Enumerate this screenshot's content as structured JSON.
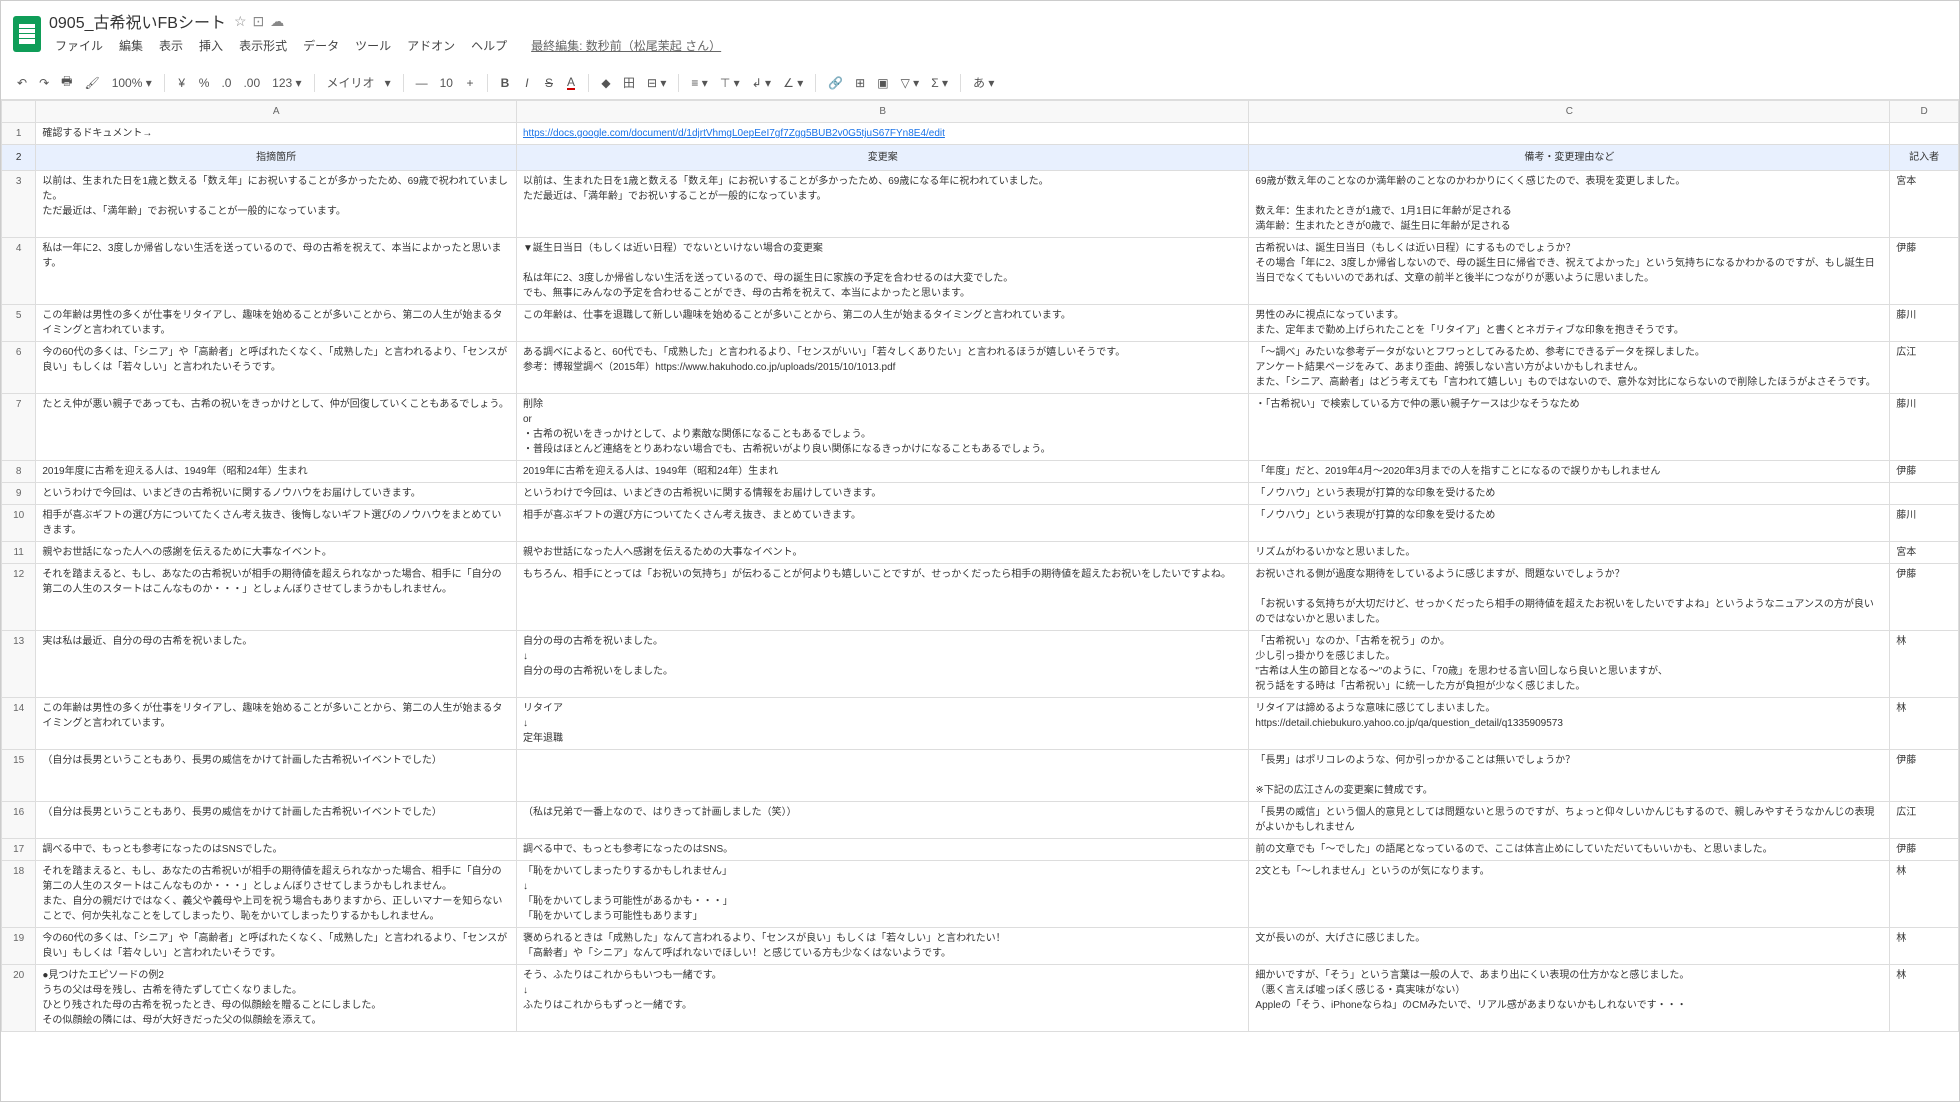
{
  "doc": {
    "title": "0905_古希祝いFBシート",
    "star": "☆",
    "folder": "⊡",
    "cloud": "☁"
  },
  "menu": {
    "file": "ファイル",
    "edit": "編集",
    "view": "表示",
    "insert": "挿入",
    "format": "表示形式",
    "data": "データ",
    "tools": "ツール",
    "addons": "アドオン",
    "help": "ヘルプ",
    "last_edit": "最終編集: 数秒前（松尾茉起 さん）"
  },
  "toolbar": {
    "undo": "↶",
    "redo": "↷",
    "print": "🖶",
    "paint": "🖌",
    "zoom": "100%",
    "dropdown": "▾",
    "currency": "¥",
    "percent": "%",
    "dec_dec": ".0",
    "dec_inc": ".00",
    "more_fmt": "123",
    "font": "メイリオ",
    "font_size": "10",
    "minus": "—",
    "bold": "B",
    "italic": "I",
    "strike": "S",
    "text_color": "A",
    "fill": "◆",
    "borders": "田",
    "merge": "⊟",
    "halign": "≡",
    "valign": "⊤",
    "wrap": "↲",
    "rotate": "∠",
    "link": "🔗",
    "comment": "⊞",
    "image": "▣",
    "filter": "▽",
    "sigma": "Σ",
    "lang": "あ"
  },
  "headers": {
    "A": "A",
    "B": "B",
    "C": "C",
    "D": "D",
    "row1_a": "確認するドキュメント→",
    "row1_b_link": "https://docs.google.com/document/d/1djrtVhmgL0epEeI7gf7Zgg5BUB2v0G5tjuS67FYn8E4/edit",
    "row2_a": "指摘箇所",
    "row2_b": "変更案",
    "row2_c": "備考・変更理由など",
    "row2_d": "記入者"
  },
  "rows": [
    {
      "n": "3",
      "a": "以前は、生まれた日を1歳と数える「数え年」にお祝いすることが多かったため、69歳で祝われていました。\nただ最近は、「満年齢」でお祝いすることが一般的になっています。",
      "b": "以前は、生まれた日を1歳と数える「数え年」にお祝いすることが多かったため、69歳になる年に祝われていました。\nただ最近は、「満年齢」でお祝いすることが一般的になっています。",
      "c": "69歳が数え年のことなのか満年齢のことなのかわかりにくく感じたので、表現を変更しました。\n\n数え年：生まれたときが1歳で、1月1日に年齢が足される\n満年齢：生まれたときが0歳で、誕生日に年齢が足される",
      "d": "宮本"
    },
    {
      "n": "4",
      "a": "私は一年に2、3度しか帰省しない生活を送っているので、母の古希を祝えて、本当によかったと思います。",
      "b": "▼誕生日当日（もしくは近い日程）でないといけない場合の変更案\n\n私は年に2、3度しか帰省しない生活を送っているので、母の誕生日に家族の予定を合わせるのは大変でした。\nでも、無事にみんなの予定を合わせることができ、母の古希を祝えて、本当によかったと思います。",
      "c": "古希祝いは、誕生日当日（もしくは近い日程）にするものでしょうか？\nその場合「年に2、3度しか帰省しないので、母の誕生日に帰省でき、祝えてよかった」という気持ちになるかわかるのですが、もし誕生日当日でなくてもいいのであれば、文章の前半と後半につながりが悪いように思いました。",
      "d": "伊藤"
    },
    {
      "n": "5",
      "a": "この年齢は男性の多くが仕事をリタイアし、趣味を始めることが多いことから、第二の人生が始まるタイミングと言われています。",
      "b": "この年齢は、仕事を退職して新しい趣味を始めることが多いことから、第二の人生が始まるタイミングと言われています。",
      "c": "男性のみに視点になっています。\nまた、定年まで勤め上げられたことを「リタイア」と書くとネガティブな印象を抱きそうです。",
      "d": "藤川"
    },
    {
      "n": "6",
      "a": "今の60代の多くは、「シニア」や「高齢者」と呼ばれたくなく、「成熟した」と言われるより、「センスが良い」もしくは「若々しい」と言われたいそうです。",
      "b": "ある調べによると、60代でも、「成熟した」と言われるより、「センスがいい」「若々しくありたい」と言われるほうが嬉しいそうです。\n参考：博報堂調べ（2015年）https://www.hakuhodo.co.jp/uploads/2015/10/1013.pdf",
      "c": "「～調べ」みたいな参考データがないとフワっとしてみるため、参考にできるデータを探しました。\nアンケート結果ページをみて、あまり歪曲、誇張しない言い方がよいかもしれません。\nまた、「シニア、高齢者」はどう考えても「言われて嬉しい」ものではないので、意外な対比にならないので削除したほうがよさそうです。",
      "d": "広江"
    },
    {
      "n": "7",
      "a": "たとえ仲が悪い親子であっても、古希の祝いをきっかけとして、仲が回復していくこともあるでしょう。",
      "b": "削除\nor\n・古希の祝いをきっかけとして、より素敵な関係になることもあるでしょう。\n・普段はほとんど連絡をとりあわない場合でも、古希祝いがより良い関係になるきっかけになることもあるでしょう。",
      "c": "・「古希祝い」で検索している方で仲の悪い親子ケースは少なそうなため",
      "d": "藤川"
    },
    {
      "n": "8",
      "a": "2019年度に古希を迎える人は、1949年（昭和24年）生まれ",
      "b": "2019年に古希を迎える人は、1949年（昭和24年）生まれ",
      "c": "「年度」だと、2019年4月～2020年3月までの人を指すことになるので誤りかもしれません",
      "d": "伊藤"
    },
    {
      "n": "9",
      "a": "というわけで今回は、いまどきの古希祝いに関するノウハウをお届けしていきます。",
      "b": "というわけで今回は、いまどきの古希祝いに関する情報をお届けしていきます。",
      "c": "「ノウハウ」という表現が打算的な印象を受けるため",
      "d": ""
    },
    {
      "n": "10",
      "a": "相手が喜ぶギフトの選び方についてたくさん考え抜き、後悔しないギフト選びのノウハウをまとめていきます。",
      "b": "相手が喜ぶギフトの選び方についてたくさん考え抜き、まとめていきます。",
      "c": "「ノウハウ」という表現が打算的な印象を受けるため",
      "d": "藤川"
    },
    {
      "n": "11",
      "a": "親やお世話になった人への感謝を伝えるために大事なイベント。",
      "b": "親やお世話になった人へ感謝を伝えるための大事なイベント。",
      "c": "リズムがわるいかなと思いました。",
      "d": "宮本"
    },
    {
      "n": "12",
      "a": "それを踏まえると、もし、あなたの古希祝いが相手の期待値を超えられなかった場合、相手に「自分の第二の人生のスタートはこんなものか・・・」としょんぼりさせてしまうかもしれません。",
      "b": "もちろん、相手にとっては「お祝いの気持ち」が伝わることが何よりも嬉しいことですが、せっかくだったら相手の期待値を超えたお祝いをしたいですよね。",
      "c": "お祝いされる側が過度な期待をしているように感じますが、問題ないでしょうか？\n\n「お祝いする気持ちが大切だけど、せっかくだったら相手の期待値を超えたお祝いをしたいですよね」というようなニュアンスの方が良いのではないかと思いました。",
      "d": "伊藤"
    },
    {
      "n": "13",
      "a": "実は私は最近、自分の母の古希を祝いました。",
      "b": "自分の母の古希を祝いました。\n↓\n自分の母の古希祝いをしました。",
      "c": "「古希祝い」なのか、「古希を祝う」のか。\n少し引っ掛かりを感じました。\n\"古希は人生の節目となる～\"のように、「70歳」を思わせる言い回しなら良いと思いますが、\n祝う話をする時は「古希祝い」に統一した方が負担が少なく感じました。",
      "d": "林"
    },
    {
      "n": "14",
      "a": "この年齢は男性の多くが仕事をリタイアし、趣味を始めることが多いことから、第二の人生が始まるタイミングと言われています。",
      "b": "リタイア\n↓\n定年退職",
      "c": "リタイアは諦めるような意味に感じてしまいました。\nhttps://detail.chiebukuro.yahoo.co.jp/qa/question_detail/q1335909573",
      "d": "林"
    },
    {
      "n": "15",
      "a": "（自分は長男ということもあり、長男の威信をかけて計画した古希祝いイベントでした）",
      "b": "",
      "c": "「長男」はポリコレのような、何か引っかかることは無いでしょうか？\n\n※下記の広江さんの変更案に賛成です。",
      "d": "伊藤"
    },
    {
      "n": "16",
      "a": "（自分は長男ということもあり、長男の威信をかけて計画した古希祝いイベントでした）",
      "b": "（私は兄弟で一番上なので、はりきって計画しました（笑））",
      "c": "「長男の威信」という個人的意見としては問題ないと思うのですが、ちょっと仰々しいかんじもするので、親しみやすそうなかんじの表現がよいかもしれません",
      "d": "広江"
    },
    {
      "n": "17",
      "a": "調べる中で、もっとも参考になったのはSNSでした。",
      "b": "調べる中で、もっとも参考になったのはSNS。",
      "c": "前の文章でも「～でした」の語尾となっているので、ここは体言止めにしていただいてもいいかも、と思いました。",
      "d": "伊藤"
    },
    {
      "n": "18",
      "a": "それを踏まえると、もし、あなたの古希祝いが相手の期待値を超えられなかった場合、相手に「自分の第二の人生のスタートはこんなものか・・・」としょんぼりさせてしまうかもしれません。\nまた、自分の親だけではなく、義父や義母や上司を祝う場合もありますから、正しいマナーを知らないことで、何か失礼なことをしてしまったり、恥をかいてしまったりするかもしれません。",
      "b": "「恥をかいてしまったりするかもしれません」\n↓\n「恥をかいてしまう可能性があるかも・・・」\n「恥をかいてしまう可能性もあります」",
      "c": "2文とも「～しれません」というのが気になります。",
      "d": "林"
    },
    {
      "n": "19",
      "a": "今の60代の多くは、「シニア」や「高齢者」と呼ばれたくなく、「成熟した」と言われるより、「センスが良い」もしくは「若々しい」と言われたいそうです。",
      "b": "褒められるときは「成熟した」なんて言われるより、「センスが良い」もしくは「若々しい」と言われたい！\n「高齢者」や「シニア」なんて呼ばれないでほしい！と感じている方も少なくはないようです。",
      "c": "文が長いのが、大げさに感じました。",
      "d": "林"
    },
    {
      "n": "20",
      "a": "●見つけたエピソードの例2\nうちの父は母を残し、古希を待たずして亡くなりました。\nひとり残された母の古希を祝ったとき、母の似顔絵を贈ることにしました。\nその似顔絵の隣には、母が大好きだった父の似顔絵を添えて。",
      "b": "そう、ふたりはこれからもいつも一緒です。\n↓\nふたりはこれからもずっと一緒です。",
      "c": "細かいですが、「そう」という言葉は一般の人で、あまり出にくい表現の仕方かなと感じました。\n（悪く言えば嘘っぽく感じる・真実味がない）\nAppleの「そう、iPhoneならね」のCMみたいで、リアル感があまりないかもしれないです・・・",
      "d": "林"
    }
  ]
}
